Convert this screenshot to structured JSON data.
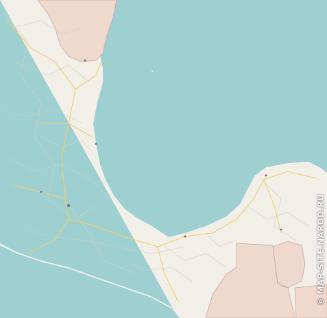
{
  "map": {
    "watermark": "© MAP-SITE.NAROD.RU",
    "colors": {
      "water": "#9ecfd1",
      "land": "#f2efe9",
      "neighbor_land": "#efd8cc",
      "border": "#c9a6a0",
      "major_road": "#f0cf6a",
      "minor_road": "#d6d0c4"
    }
  }
}
